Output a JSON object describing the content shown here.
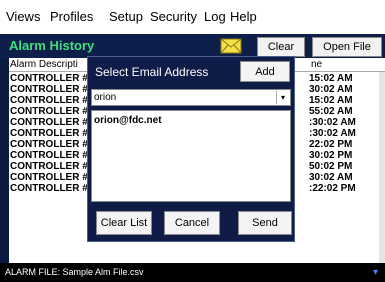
{
  "menu": [
    "Views",
    "Profiles",
    "Setup",
    "Security",
    "Log",
    "Help"
  ],
  "window": {
    "title": "Alarm History",
    "clear_label": "Clear",
    "open_file_label": "Open File"
  },
  "table": {
    "col_description": "Alarm Descripti",
    "col_time": "ne",
    "rows": [
      {
        "name": "CONTROLLER #",
        "time": "15:02 AM"
      },
      {
        "name": "CONTROLLER #",
        "time": "30:02 AM"
      },
      {
        "name": "CONTROLLER #",
        "time": "15:02 AM"
      },
      {
        "name": "CONTROLLER #",
        "time": "55:02 AM"
      },
      {
        "name": "CONTROLLER #",
        "time": ":30:02 AM"
      },
      {
        "name": "CONTROLLER #",
        "time": ":30:02 AM"
      },
      {
        "name": "CONTROLLER #",
        "time": "22:02 PM"
      },
      {
        "name": "CONTROLLER #",
        "time": "30:02 PM"
      },
      {
        "name": "CONTROLLER #",
        "time": "50:02 PM"
      },
      {
        "name": "CONTROLLER #",
        "time": "30:02 AM"
      },
      {
        "name": "CONTROLLER #",
        "time": ":22:02 PM"
      }
    ]
  },
  "dialog": {
    "title": "Select Email Address",
    "add_label": "Add",
    "combo_value": "orion",
    "list_items": [
      "orion@fdc.net"
    ],
    "clear_list_label": "Clear List",
    "cancel_label": "Cancel",
    "send_label": "Send"
  },
  "status": {
    "text": "ALARM FILE: Sample Alm File.csv"
  },
  "colors": {
    "title_green": "#3fe07a",
    "dialog_bg": "#101c48",
    "window_bg": "#0b1a40"
  }
}
